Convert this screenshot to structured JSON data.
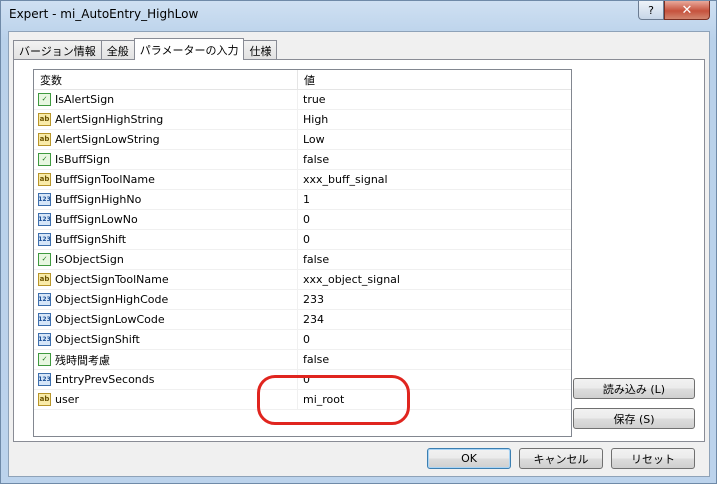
{
  "window": {
    "title": "Expert - mi_AutoEntry_HighLow",
    "help_label": "?",
    "close_label": "✕"
  },
  "tabs": [
    {
      "label": "バージョン情報"
    },
    {
      "label": "全般"
    },
    {
      "label": "パラメーターの入力",
      "active": true
    },
    {
      "label": "仕様"
    }
  ],
  "grid": {
    "headers": {
      "variable": "変数",
      "value": "値"
    },
    "rows": [
      {
        "type": "bool",
        "name": "IsAlertSign",
        "value": "true"
      },
      {
        "type": "str",
        "name": "AlertSignHighString",
        "value": "High"
      },
      {
        "type": "str",
        "name": "AlertSignLowString",
        "value": "Low"
      },
      {
        "type": "bool",
        "name": "IsBuffSign",
        "value": "false"
      },
      {
        "type": "str",
        "name": "BuffSignToolName",
        "value": "xxx_buff_signal"
      },
      {
        "type": "int",
        "name": "BuffSignHighNo",
        "value": "1"
      },
      {
        "type": "int",
        "name": "BuffSignLowNo",
        "value": "0"
      },
      {
        "type": "int",
        "name": "BuffSignShift",
        "value": "0"
      },
      {
        "type": "bool",
        "name": "IsObjectSign",
        "value": "false"
      },
      {
        "type": "str",
        "name": "ObjectSignToolName",
        "value": "xxx_object_signal"
      },
      {
        "type": "int",
        "name": "ObjectSignHighCode",
        "value": "233"
      },
      {
        "type": "int",
        "name": "ObjectSignLowCode",
        "value": "234"
      },
      {
        "type": "int",
        "name": "ObjectSignShift",
        "value": "0"
      },
      {
        "type": "bool",
        "name": "残時間考慮",
        "value": "false"
      },
      {
        "type": "int",
        "name": "EntryPrevSeconds",
        "value": "0"
      },
      {
        "type": "str",
        "name": "user",
        "value": "mi_root"
      }
    ]
  },
  "icons": {
    "bool": "bool-type-icon",
    "str": "string-type-icon",
    "int": "integer-type-icon"
  },
  "icon_glyphs": {
    "bool": "✓",
    "str": "ab",
    "int": "123"
  },
  "buttons": {
    "load": "読み込み (L)",
    "save": "保存 (S)",
    "ok": "OK",
    "cancel": "キャンセル",
    "reset": "リセット"
  },
  "annotation_color": "#e0251f"
}
